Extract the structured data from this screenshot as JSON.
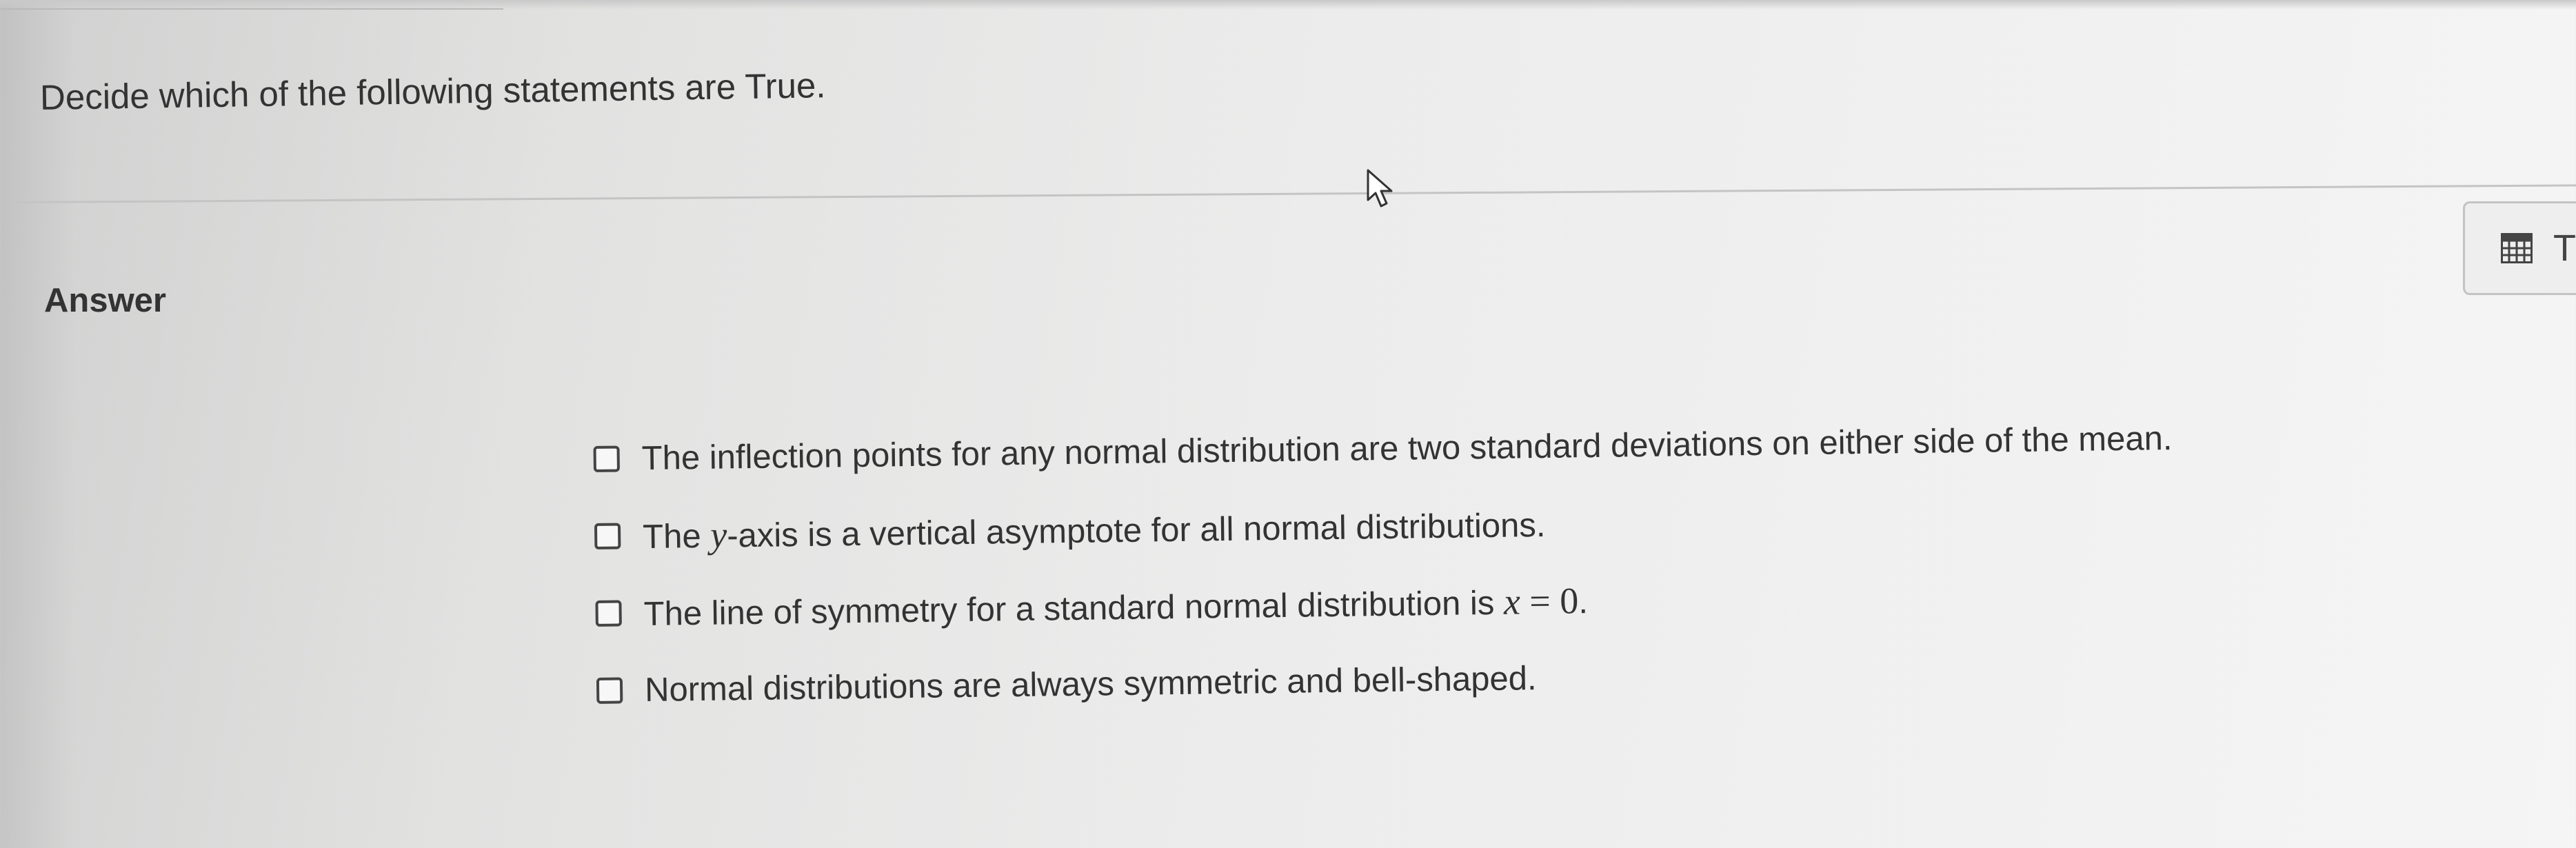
{
  "question": {
    "text": "Decide which of the following statements are True."
  },
  "answer": {
    "label": "Answer"
  },
  "options": [
    {
      "text": "The inflection points for any normal distribution are two standard deviations on either side of the mean.",
      "checked": false
    },
    {
      "text_before": "The ",
      "math": "y",
      "text_after": "-axis is a vertical asymptote for all normal distributions.",
      "checked": false
    },
    {
      "text_before": "The line of symmetry for a standard normal distribution is ",
      "math_var": "x",
      "math_rest": " = 0",
      "text_after": ".",
      "checked": false
    },
    {
      "text": "Normal distributions are always symmetric and bell-shaped.",
      "checked": false
    }
  ],
  "side_tool": {
    "icon": "calculator-icon",
    "letter": "T"
  },
  "icons": {
    "cursor": "mouse-pointer-icon",
    "checkbox": "checkbox-icon"
  }
}
